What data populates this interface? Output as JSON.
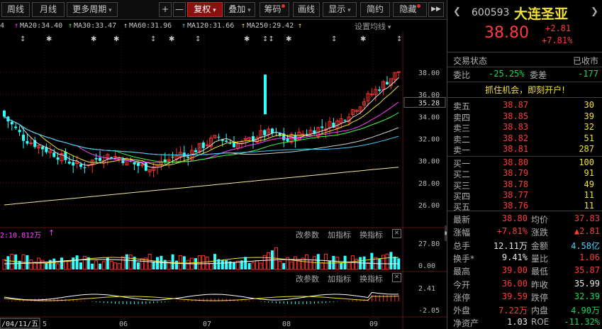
{
  "toolbar": {
    "items": [
      {
        "label": "周线",
        "x": 2,
        "w": 40
      },
      {
        "label": "月线",
        "x": 45,
        "w": 46
      },
      {
        "label": "更多周期",
        "x": 94,
        "w": 70,
        "caret": true
      }
    ],
    "plus": "+",
    "minus": "—",
    "fuquan": "复权",
    "diejia": "叠加",
    "chouma": "筹码",
    "huaxian": "画线",
    "xianshi": "显示",
    "jianyue": "简约",
    "yincang": "隐藏",
    "more": "▶▶"
  },
  "ma_legend": [
    {
      "text": "4",
      "color": "#e0e0e0"
    },
    {
      "text": "MA20:34.40",
      "color": "#ff40ff"
    },
    {
      "text": "MA30:33.47",
      "color": "#40ff40"
    },
    {
      "text": "MA60:31.96",
      "color": "#e0e0e0"
    },
    {
      "text": "MA120:31.66",
      "color": "#40c8ff"
    },
    {
      "text": "MA250:29.42",
      "color": "#f0e060"
    }
  ],
  "settings_ma": "设置均线",
  "price_axis": [
    "38.00",
    "36.00",
    "34.00",
    "32.00",
    "30.00",
    "28.00",
    "26.00"
  ],
  "current_price_tag": "35.28",
  "volume_panel": {
    "label": "2:10.812万",
    "change_params": "改参数",
    "add_indicator": "加指标",
    "switch_indicator": "换指标",
    "close": "✕",
    "axis_top": "27.80",
    "axis_bottom": "0.00"
  },
  "macd_panel": {
    "change_params": "改参数",
    "add_indicator": "加指标",
    "switch_indicator": "换指标",
    "close": "✕",
    "axis_top": "2.41",
    "axis_bottom": "-2.05"
  },
  "date_axis": {
    "date_box": "/04/11/五",
    "ticks": [
      "5",
      "06",
      "07",
      "08",
      "09"
    ]
  },
  "stock": {
    "code": "600593",
    "name": "大连圣亚",
    "price": "38.80",
    "change": "+2.81",
    "change_pct": "+7.81%",
    "trade_status_label": "交易状态",
    "trade_status": "已收市",
    "weibi_label": "委比",
    "weibi": "-25.25%",
    "weicha_label": "委差",
    "weicha": "-177",
    "promo": "抓住机会，即刻开户!"
  },
  "asks": [
    {
      "label": "卖五",
      "price": "38.87",
      "vol": "30"
    },
    {
      "label": "卖四",
      "price": "38.85",
      "vol": "39"
    },
    {
      "label": "卖三",
      "price": "38.83",
      "vol": "32"
    },
    {
      "label": "卖二",
      "price": "38.82",
      "vol": "51"
    },
    {
      "label": "卖一",
      "price": "38.81",
      "vol": "287"
    }
  ],
  "bids": [
    {
      "label": "买一",
      "price": "38.80",
      "vol": "100"
    },
    {
      "label": "买二",
      "price": "38.79",
      "vol": "91"
    },
    {
      "label": "买三",
      "price": "38.78",
      "vol": "49"
    },
    {
      "label": "买四",
      "price": "38.77",
      "vol": "11"
    },
    {
      "label": "买五",
      "price": "38.76",
      "vol": "11"
    }
  ],
  "stats": [
    {
      "l1": "最新",
      "v1": "38.80",
      "c1": "red",
      "l2": "均价",
      "v2": "37.83",
      "c2": "red"
    },
    {
      "l1": "涨幅",
      "v1": "+7.81%",
      "c1": "red",
      "l2": "涨跌",
      "v2": "▲2.81",
      "c2": "red"
    },
    {
      "l1": "总手",
      "v1": "12.11万",
      "c1": "white",
      "l2": "金额",
      "v2": "4.58亿",
      "c2": "cyan"
    },
    {
      "l1": "换手*",
      "v1": "9.41%",
      "c1": "white",
      "l2": "量比",
      "v2": "1.06",
      "c2": "red"
    },
    {
      "l1": "最高",
      "v1": "39.00",
      "c1": "red",
      "l2": "最低",
      "v2": "35.87",
      "c2": "red"
    },
    {
      "l1": "今开",
      "v1": "36.00",
      "c1": "red",
      "l2": "昨收",
      "v2": "35.99",
      "c2": "white"
    },
    {
      "l1": "涨停",
      "v1": "39.59",
      "c1": "red",
      "l2": "跌停",
      "v2": "32.39",
      "c2": "green"
    },
    {
      "l1": "外盘",
      "v1": "7.22万",
      "c1": "red",
      "l2": "内盘",
      "v2": "4.90万",
      "c2": "green"
    },
    {
      "l1": "净资产",
      "v1": "1.03",
      "c1": "white",
      "l2": "ROE",
      "v2": "-11.32%",
      "c2": "green"
    }
  ]
}
